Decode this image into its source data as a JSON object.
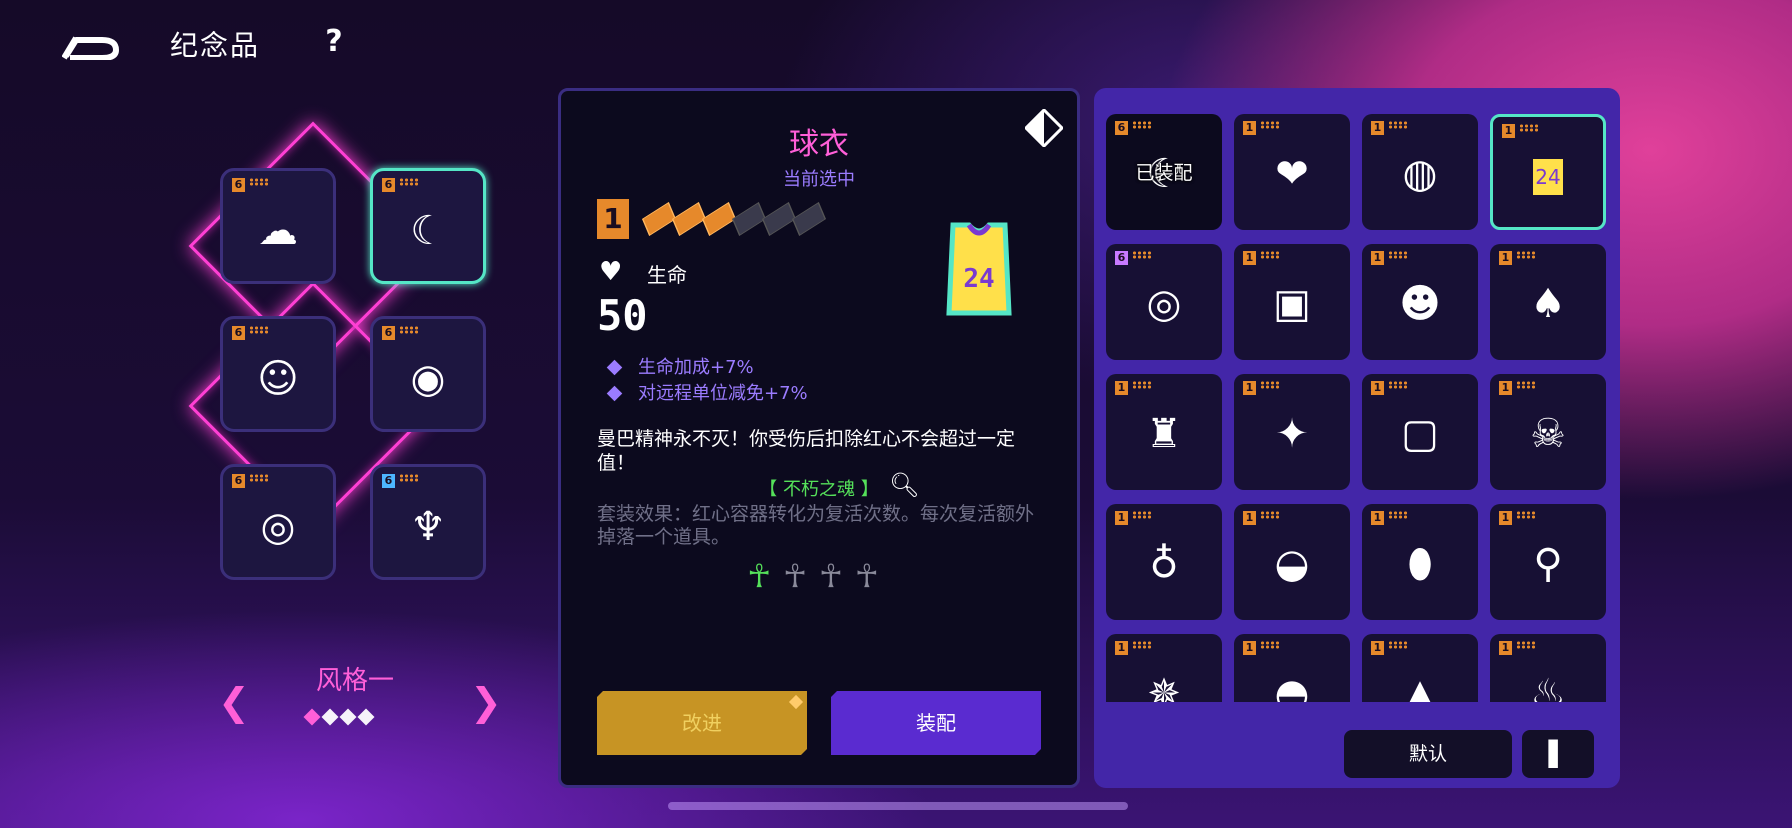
{
  "header": {
    "title": "纪念品",
    "help": "?"
  },
  "loadout": {
    "slots": [
      {
        "tier": "6",
        "icon": "2077-icon",
        "glyph": "☁",
        "selected": false
      },
      {
        "tier": "6",
        "icon": "horn-icon",
        "glyph": "☾",
        "selected": true
      },
      {
        "tier": "6",
        "icon": "gingerbread-icon",
        "glyph": "☺",
        "selected": false
      },
      {
        "tier": "6",
        "icon": "gem-icon",
        "glyph": "◉",
        "selected": false
      },
      {
        "tier": "6",
        "icon": "donut-icon",
        "glyph": "◎",
        "selected": false
      },
      {
        "tier": "6",
        "icon": "trophy-icon",
        "glyph": "♆",
        "selected": false
      }
    ],
    "style_label": "风格一",
    "page_count": 4,
    "page_current": 1
  },
  "detail": {
    "name": "球衣",
    "status": "当前选中",
    "level": "1",
    "level_progress": 0.5,
    "stat_name": "生命",
    "stat_value": "50",
    "bonuses": [
      "生命加成+7%",
      "对远程单位减免+7%"
    ],
    "description": "曼巴精神永不灭！你受伤后扣除红心不会超过一定值！",
    "set_name": "【 不朽之魂 】",
    "set_description": "套装效果：红心容器转化为复活次数。每次复活额外掉落一个道具。",
    "set_pieces_owned": 1,
    "set_pieces_total": 4,
    "upgrade_label": "改进",
    "equip_label": "装配",
    "jersey_number": "24",
    "colors": {
      "accent": "#ff5fd8",
      "sub": "#9b7cff",
      "upgrade": "#c79424",
      "equip": "#5a2bd0",
      "set": "#55e05a"
    }
  },
  "inventory": {
    "equipped_label": "已装配",
    "items": [
      {
        "tier": "6",
        "icon": "horn-icon",
        "glyph": "☾",
        "equipped": true
      },
      {
        "tier": "1",
        "icon": "heart-amulet-icon",
        "glyph": "❤"
      },
      {
        "tier": "1",
        "icon": "baseball-icon",
        "glyph": "◍"
      },
      {
        "tier": "1",
        "icon": "jersey-icon",
        "glyph": "24",
        "selected": true
      },
      {
        "tier": "6",
        "icon": "target-icon",
        "glyph": "◎"
      },
      {
        "tier": "1",
        "icon": "chest-icon",
        "glyph": "▣"
      },
      {
        "tier": "1",
        "icon": "devil-mask-icon",
        "glyph": "☻"
      },
      {
        "tier": "1",
        "icon": "acorn-icon",
        "glyph": "♠"
      },
      {
        "tier": "1",
        "icon": "cloak-icon",
        "glyph": "♜"
      },
      {
        "tier": "1",
        "icon": "gem-necklace-icon",
        "glyph": "✦"
      },
      {
        "tier": "1",
        "icon": "card-icon",
        "glyph": "▢"
      },
      {
        "tier": "1",
        "icon": "panda-skull-icon",
        "glyph": "☠"
      },
      {
        "tier": "1",
        "icon": "pouch-icon",
        "glyph": "♁"
      },
      {
        "tier": "1",
        "icon": "helmet-icon",
        "glyph": "◒"
      },
      {
        "tier": "1",
        "icon": "lantern-icon",
        "glyph": "⬮"
      },
      {
        "tier": "1",
        "icon": "magnifier-icon",
        "glyph": "⚲"
      },
      {
        "tier": "1",
        "icon": "spider-icon",
        "glyph": "✵"
      },
      {
        "tier": "1",
        "icon": "bowl-icon",
        "glyph": "◓"
      },
      {
        "tier": "1",
        "icon": "rocket-icon",
        "glyph": "▲"
      },
      {
        "tier": "1",
        "icon": "potion-icon",
        "glyph": "♨"
      }
    ],
    "default_label": "默认",
    "sort_glyph": "▌"
  }
}
